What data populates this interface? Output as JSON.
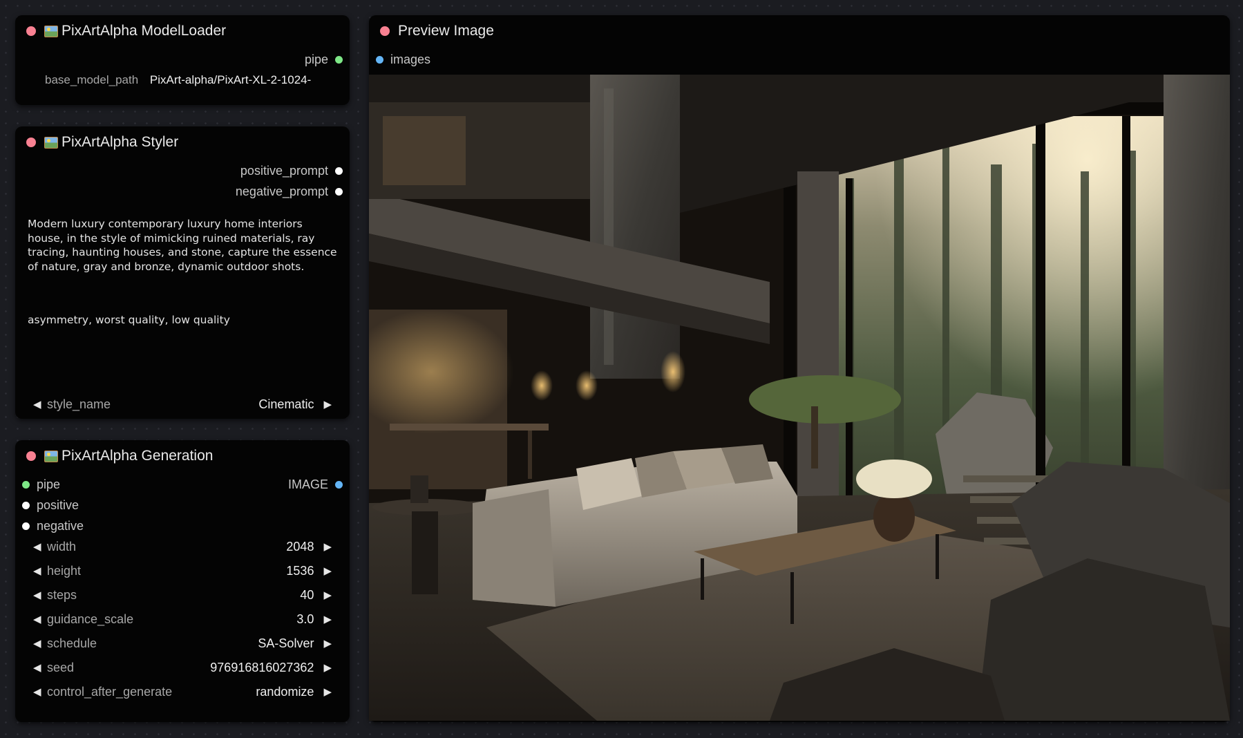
{
  "model_loader": {
    "title": "PixArtAlpha ModelLoader",
    "output_pipe": "pipe",
    "base_model_path_label": "base_model_path",
    "base_model_path_value": "PixArt-alpha/PixArt-XL-2-1024-"
  },
  "styler": {
    "title": "PixArtAlpha Styler",
    "output_positive": "positive_prompt",
    "output_negative": "negative_prompt",
    "positive_text": "Modern luxury contemporary luxury home interiors house, in the style of mimicking ruined materials, ray tracing, haunting houses, and stone, capture the essence of nature, gray and bronze, dynamic outdoor shots.",
    "negative_text": "asymmetry, worst quality, low quality",
    "style_name_label": "style_name",
    "style_name_value": "Cinematic"
  },
  "generation": {
    "title": "PixArtAlpha Generation",
    "input_pipe": "pipe",
    "input_positive": "positive",
    "input_negative": "negative",
    "output_image": "IMAGE",
    "widgets": {
      "width": {
        "label": "width",
        "value": "2048"
      },
      "height": {
        "label": "height",
        "value": "1536"
      },
      "steps": {
        "label": "steps",
        "value": "40"
      },
      "guidance_scale": {
        "label": "guidance_scale",
        "value": "3.0"
      },
      "schedule": {
        "label": "schedule",
        "value": "SA-Solver"
      },
      "seed": {
        "label": "seed",
        "value": "976916816027362"
      },
      "control_after_generate": {
        "label": "control_after_generate",
        "value": "randomize"
      }
    }
  },
  "preview": {
    "title": "Preview Image",
    "input_images": "images",
    "image_description": "luxury living room with stone walls, sofa, coffee table and forest view"
  },
  "colors": {
    "node_bg": "#040404",
    "title_dot": "#f98192",
    "pin_pipe": "#7ee787",
    "pin_string": "#ffffff",
    "pin_image": "#64b5f6",
    "canvas_bg": "#1b1c21"
  },
  "icons": {
    "node_icon": "picture-frame-icon",
    "decrement": "triangle-left-icon",
    "increment": "triangle-right-icon"
  }
}
